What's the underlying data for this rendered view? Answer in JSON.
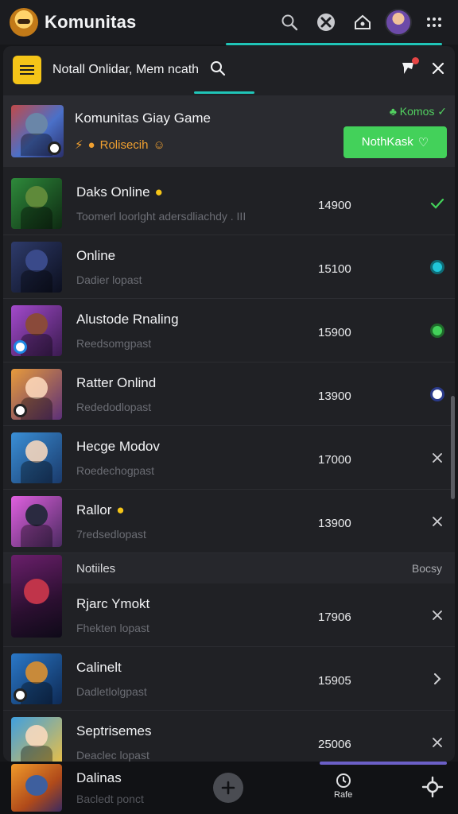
{
  "app": {
    "title": "Komunitas"
  },
  "panel": {
    "search_text": "Notall Onlidar, Mem  ncath",
    "featured": {
      "name": "Komunitas Giay Game",
      "sub": "Rolisecih",
      "tag": "Komos",
      "button": "NothKask"
    },
    "rows": [
      {
        "name": "Daks Online",
        "sub": "Toomerl loorlght adersdliachdy  . III",
        "count": "14900",
        "emoji": true,
        "action": "check",
        "colors": [
          "#2e8a3b",
          "#0e2a12"
        ]
      },
      {
        "name": "Online",
        "sub": "Dadier lopast",
        "count": "15100",
        "emoji": false,
        "action": "dot-teal",
        "colors": [
          "#2e3b6b",
          "#0c0f1e"
        ]
      },
      {
        "name": "Alustode Rnaling",
        "sub": "Reedsomgpast",
        "count": "15900",
        "emoji": false,
        "action": "dot-green",
        "colors": [
          "#a34acc",
          "#3a1b4f"
        ]
      },
      {
        "name": "Ratter Onlind",
        "sub": "Rededodlopast",
        "count": "13900",
        "emoji": false,
        "action": "dot-white",
        "colors": [
          "#e89b3b",
          "#5b2f78"
        ]
      },
      {
        "name": "Hecge Modov",
        "sub": "Roedechogpast",
        "count": "17000",
        "emoji": false,
        "action": "close",
        "colors": [
          "#3a8fd6",
          "#1a3a6b"
        ]
      },
      {
        "name": "Rallor",
        "sub": "7redsedlopast",
        "count": "13900",
        "emoji": true,
        "action": "close",
        "colors": [
          "#e060e0",
          "#4a2a60"
        ]
      }
    ],
    "section": {
      "title": "Notiiles",
      "side": "Bocsy"
    },
    "rows2": [
      {
        "name": "Rjarc Ymokt",
        "sub": "Fhekten lopast",
        "count": "17906",
        "action": "close"
      },
      {
        "name": "Calinelt",
        "sub": "Dadletlolgpast",
        "count": "15905",
        "action": "chevron",
        "colors": [
          "#2a78c8",
          "#0e2a55"
        ]
      },
      {
        "name": "Septrisemes",
        "sub": "Deaclec lopast",
        "count": "25006",
        "action": "close",
        "colors": [
          "#3fa0e0",
          "#f0c040"
        ]
      }
    ]
  },
  "bottom": {
    "name": "Dalinas",
    "sub": "Bacledt ponct",
    "nav_label": "Rafe"
  }
}
